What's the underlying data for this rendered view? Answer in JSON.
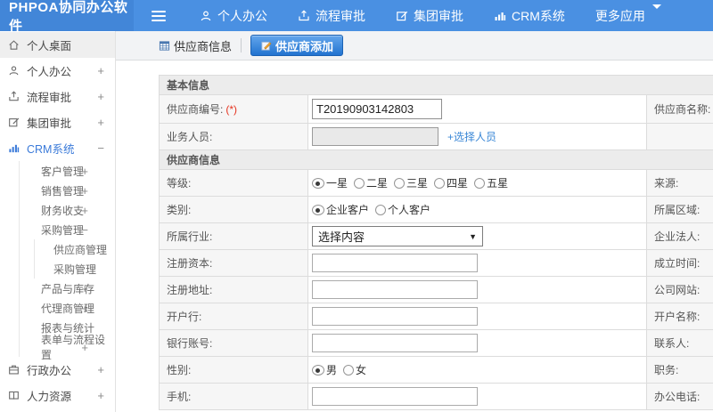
{
  "colors": {
    "topbar": "#4a90e2",
    "topbar_logo": "#4286d8",
    "link": "#3a87d6",
    "required": "#e5321e"
  },
  "topbar": {
    "logo": "PHPOA协同办公软件",
    "nav": [
      {
        "label": "个人办公",
        "icon": "user-icon"
      },
      {
        "label": "流程审批",
        "icon": "upload-icon"
      },
      {
        "label": "集团审批",
        "icon": "edit-icon"
      },
      {
        "label": "CRM系统",
        "icon": "chart-icon"
      },
      {
        "label": "更多应用",
        "icon": "caret-down-icon"
      }
    ]
  },
  "sidebar": {
    "items": [
      {
        "label": "个人桌面",
        "icon": "home-icon",
        "level": 0,
        "marker": "",
        "active": true
      },
      {
        "label": "个人办公",
        "icon": "user-icon",
        "level": 0,
        "marker": "+"
      },
      {
        "label": "流程审批",
        "icon": "upload-icon",
        "level": 0,
        "marker": "+"
      },
      {
        "label": "集团审批",
        "icon": "edit-icon",
        "level": 0,
        "marker": "+"
      },
      {
        "label": "CRM系统",
        "icon": "chart-icon",
        "level": 0,
        "marker": "−",
        "highlight": true
      },
      {
        "label": "客户管理",
        "level": 1,
        "marker": "+"
      },
      {
        "label": "销售管理",
        "level": 1,
        "marker": "+"
      },
      {
        "label": "财务收支",
        "level": 1,
        "marker": "+"
      },
      {
        "label": "采购管理",
        "level": 1,
        "marker": "−"
      },
      {
        "label": "供应商管理",
        "level": 2,
        "marker": ""
      },
      {
        "label": "采购管理",
        "level": 2,
        "marker": ""
      },
      {
        "label": "产品与库存",
        "level": 1,
        "marker": "+"
      },
      {
        "label": "代理商管理",
        "level": 1,
        "marker": "+"
      },
      {
        "label": "报表与统计",
        "level": 1,
        "marker": ""
      },
      {
        "label": "表单与流程设置",
        "level": 1,
        "marker": "+"
      },
      {
        "label": "行政办公",
        "icon": "briefcase-icon",
        "level": 0,
        "marker": "+"
      },
      {
        "label": "人力资源",
        "icon": "book-icon",
        "level": 0,
        "marker": "+"
      }
    ]
  },
  "tabs": [
    {
      "label": "供应商信息",
      "icon": "table-icon",
      "active": false
    },
    {
      "label": "供应商添加",
      "icon": "pencil-icon",
      "active": true
    }
  ],
  "form": {
    "required_marker": "(*)",
    "sections": [
      {
        "title": "基本信息",
        "rows": [
          {
            "label": "供应商编号:",
            "required": true,
            "field": {
              "type": "text",
              "value": "T20190903142803",
              "variant": "id"
            },
            "right_label": "供应商名称:",
            "right_required": true
          },
          {
            "label": "业务人员:",
            "field": {
              "type": "disabled-text",
              "value": "",
              "link": "+选择人员"
            },
            "right_label": ""
          }
        ]
      },
      {
        "title": "供应商信息",
        "rows": [
          {
            "label": "等级:",
            "field": {
              "type": "radios",
              "options": [
                {
                  "label": "一星",
                  "selected": true
                },
                {
                  "label": "二星"
                },
                {
                  "label": "三星"
                },
                {
                  "label": "四星"
                },
                {
                  "label": "五星"
                }
              ]
            },
            "right_label": "来源:"
          },
          {
            "label": "类别:",
            "field": {
              "type": "radios",
              "options": [
                {
                  "label": "企业客户",
                  "selected": true
                },
                {
                  "label": "个人客户"
                }
              ]
            },
            "right_label": "所属区域:"
          },
          {
            "label": "所属行业:",
            "field": {
              "type": "select",
              "value": "选择内容"
            },
            "right_label": "企业法人:"
          },
          {
            "label": "注册资本:",
            "field": {
              "type": "text",
              "value": ""
            },
            "right_label": "成立时间:"
          },
          {
            "label": "注册地址:",
            "field": {
              "type": "text",
              "value": ""
            },
            "right_label": "公司网站:"
          },
          {
            "label": "开户行:",
            "field": {
              "type": "text",
              "value": ""
            },
            "right_label": "开户名称:"
          },
          {
            "label": "银行账号:",
            "field": {
              "type": "text",
              "value": ""
            },
            "right_label": "联系人:"
          },
          {
            "label": "性别:",
            "field": {
              "type": "radios",
              "options": [
                {
                  "label": "男",
                  "selected": true
                },
                {
                  "label": "女"
                }
              ]
            },
            "right_label": "职务:"
          },
          {
            "label": "手机:",
            "field": {
              "type": "text",
              "value": ""
            },
            "right_label": "办公电话:"
          }
        ]
      }
    ]
  }
}
